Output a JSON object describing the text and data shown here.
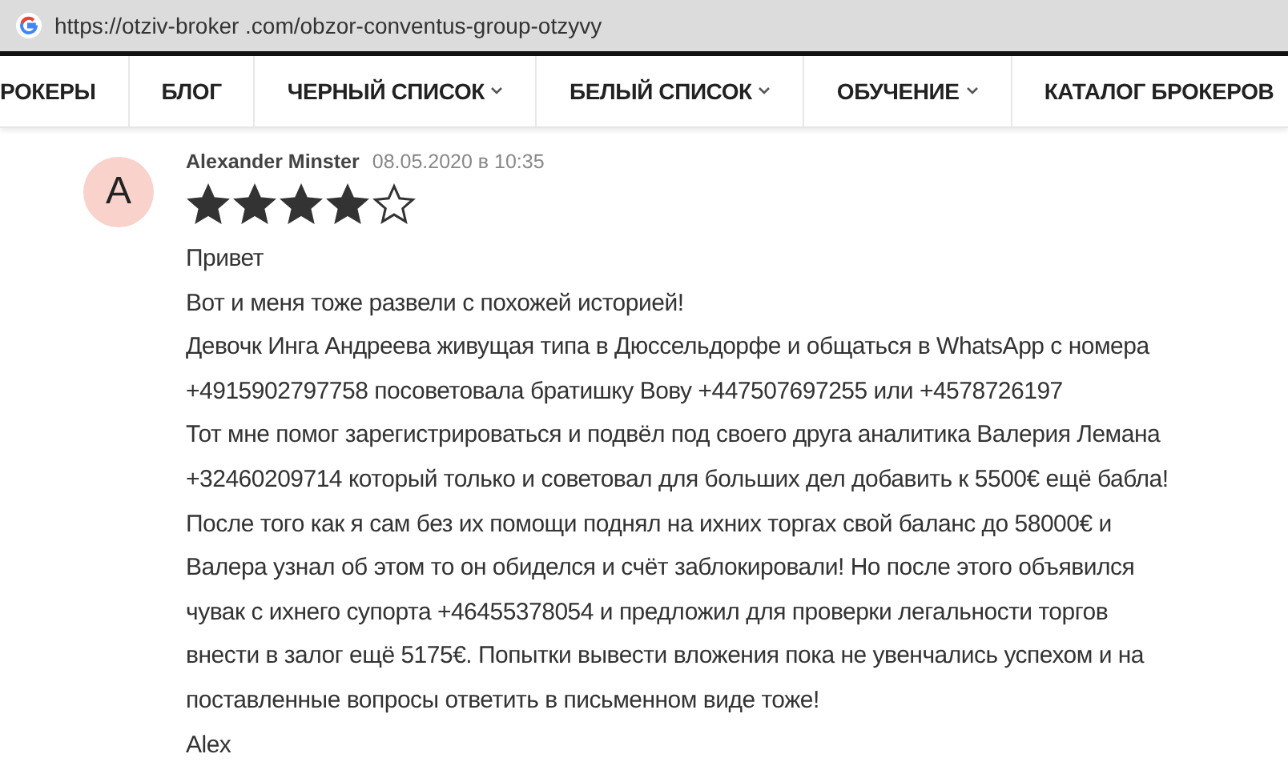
{
  "address_bar": {
    "url": "https://otziv-broker .com/obzor-conventus-group-otzyvy"
  },
  "nav": [
    {
      "label": "РОКЕРЫ",
      "dropdown": false
    },
    {
      "label": "БЛОГ",
      "dropdown": false
    },
    {
      "label": "ЧЕРНЫЙ СПИСОК",
      "dropdown": true
    },
    {
      "label": "БЕЛЫЙ СПИСОК",
      "dropdown": true
    },
    {
      "label": "ОБУЧЕНИЕ",
      "dropdown": true
    },
    {
      "label": "КАТАЛОГ БРОКЕРОВ",
      "dropdown": false
    }
  ],
  "review": {
    "avatar_letter": "A",
    "author": "Alexander Minster",
    "date": "08.05.2020 в 10:35",
    "stars": 4,
    "lines": [
      "Привет",
      "Вот и меня тоже развели с похожей историей!",
      "Девочк Инга Андреева живущая типа в Дюссельдорфе и общаться в WhatsApp с номера",
      "+4915902797758 посоветовала братишку Вову +447507697255 или +4578726197",
      "Тот мне помог зарегистрироваться и подвёл под своего друга аналитика Валерия Лемана",
      "+32460209714 который только и советовал для больших дел добавить к 5500€ ещё бабла!",
      "После того как я сам без их помощи поднял на ихних торгах свой баланс до 58000€ и",
      "Валера узнал об этом то он обиделся и счёт заблокировали! Но после этого объявился",
      "чувак с ихнего супорта +46455378054 и предложил для проверки легальности торгов",
      "внести в залог ещё 5175€. Попытки вывести вложения пока не увенчались успехом и на",
      "поставленные вопросы ответить в письменном виде тоже!",
      "Alex"
    ]
  }
}
